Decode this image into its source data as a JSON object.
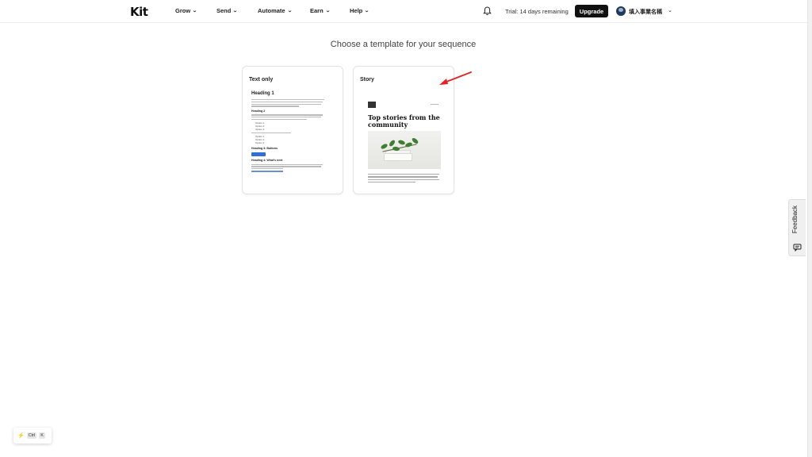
{
  "header": {
    "logo": "Kit",
    "nav": [
      {
        "label": "Grow"
      },
      {
        "label": "Send"
      },
      {
        "label": "Automate"
      },
      {
        "label": "Earn"
      },
      {
        "label": "Help"
      }
    ],
    "trial_text": "Trial: 14 days remaining",
    "upgrade_label": "Upgrade",
    "account_name": "填入事業名稱",
    "icons": {
      "bell": "bell-icon",
      "chevron": "chevron-down-icon",
      "avatar": "user-avatar"
    }
  },
  "main": {
    "title": "Choose a template for your sequence",
    "templates": [
      {
        "title": "Text only",
        "preview": {
          "heading1": "Heading 1",
          "heading2": "Heading 2",
          "list_items": [
            "Option 1",
            "Option 2",
            "Option 3"
          ],
          "numbered_items": [
            "Option 1",
            "Option 2",
            "Option 3"
          ],
          "heading3": "Heading 3: Buttons",
          "heading4": "Heading 4: What's next"
        }
      },
      {
        "title": "Story",
        "preview": {
          "headline": "Top stories from the community"
        }
      }
    ]
  },
  "feedback_tab": {
    "label": "Feedback",
    "icon": "chat-icon"
  },
  "command_hint": {
    "keys": [
      "Ctrl",
      "K"
    ],
    "icon": "bolt-icon"
  },
  "colors": {
    "annotation_arrow": "#e02424",
    "upgrade_bg": "#111111",
    "link_blue": "#2f6fd6"
  }
}
